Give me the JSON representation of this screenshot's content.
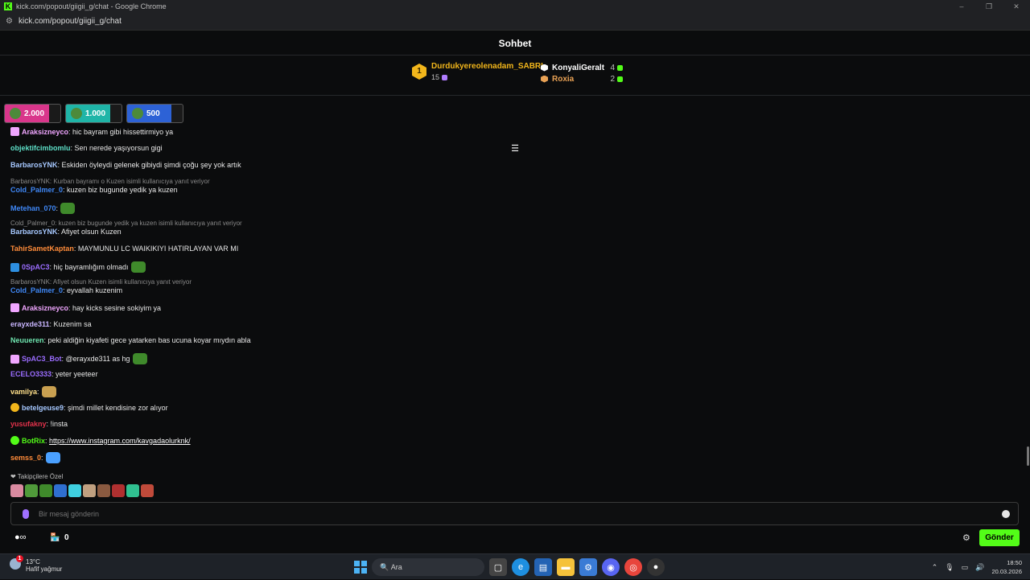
{
  "window": {
    "title": "kick.com/popout/giigii_g/chat - Google Chrome",
    "url": "kick.com/popout/giigii_g/chat",
    "controls": [
      "–",
      "❐",
      "✕"
    ]
  },
  "chat": {
    "title": "Sohbet"
  },
  "leaderboard": {
    "first": {
      "rank": "1",
      "name": "Durdukyereolenadam_SABRI",
      "count": "15"
    },
    "second": {
      "name": "KonyaliGeralt",
      "count": "4"
    },
    "third": {
      "name": "Roxia",
      "count": "2"
    },
    "colors": {
      "first": "#f2b61b",
      "second": "#ffffff",
      "third": "#e9a255"
    }
  },
  "gifts": [
    {
      "amount": "2.000",
      "color": "#d9368b"
    },
    {
      "amount": "1.000",
      "color": "#1fb5a8"
    },
    {
      "amount": "500",
      "color": "#2d62d6"
    }
  ],
  "messages": [
    {
      "user": "Araksizneyco",
      "color": "#f0a6ff",
      "text": ": hic bayram gibi hissettirmiyo ya",
      "badge": "butterfly"
    },
    {
      "user": "objektifcimbomlu",
      "color": "#5ee0c8",
      "text": ": Sen nerede yaşıyorsun gigi"
    },
    {
      "user": "BarbarosYNK",
      "color": "#a6c8ff",
      "text": ": Eskiden öyleydi gelenek gibiydi şimdi çoğu şey yok artık"
    },
    {
      "reply": "BarbarosYNK: Kurban bayramı o Kuzen isimli kullanıcıya yanıt veriyor",
      "user": "Cold_Palmer_0",
      "color": "#3f87f5",
      "text": ": kuzen biz bugunde yedik ya kuzen"
    },
    {
      "user": "Metehan_070",
      "color": "#3f87f5",
      "text": ":",
      "emote": "frog"
    },
    {
      "reply": "Cold_Palmer_0: kuzen biz bugunde yedik ya kuzen isimli kullanıcıya yanıt veriyor",
      "user": "BarbarosYNK",
      "color": "#a6c8ff",
      "text": ": Afiyet olsun Kuzen"
    },
    {
      "user": "TahirSametKaptan",
      "color": "#ff8c3a",
      "text": ": MAYMUNLU LC WAIKIKIYI HATIRLAYAN VAR MI"
    },
    {
      "user": "0SpAC3",
      "color": "#9b6dff",
      "text": ": hiç bayramlığım olmadı",
      "badge": "sub",
      "emote": "frog"
    },
    {
      "reply": "BarbarosYNK: Afiyet olsun Kuzen isimli kullanıcıya yanıt veriyor",
      "user": "Cold_Palmer_0",
      "color": "#3f87f5",
      "text": ": eyvallah kuzenim"
    },
    {
      "user": "Araksizneyco",
      "color": "#f0a6ff",
      "text": ": hay kicks sesine sokiyim ya",
      "badge": "butterfly"
    },
    {
      "user": "erayxde311",
      "color": "#c9b6ff",
      "text": ": Kuzenim sa"
    },
    {
      "user": "Neuueren",
      "color": "#6fe6b0",
      "text": ": peki aldiğin kiyafeti gece yatarken bas ucuna koyar mıydın abla"
    },
    {
      "user": "SpAC3_Bot",
      "color": "#9b6dff",
      "text": ": @erayxde311 as hg",
      "badge": "butterfly",
      "emote": "frog"
    },
    {
      "user": "ECELO3333",
      "color": "#9b6dff",
      "text": ": yeter yeeteer"
    },
    {
      "user": "vamilya",
      "color": "#ffe08a",
      "text": ":",
      "emote": "hands"
    },
    {
      "user": "betelgeuse9",
      "color": "#a6c8ff",
      "text": ": şimdi millet kendisine zor alıyor",
      "badge": "gold"
    },
    {
      "user": "yusufakny",
      "color": "#e2324b",
      "text": ": !insta"
    },
    {
      "user": "BotRix",
      "color": "#53fc18",
      "text": ": ",
      "link": "https://www.instagram.com/kavgadaolurknk/",
      "badge": "verified"
    },
    {
      "user": "semss_0",
      "color": "#ff8c3a",
      "text": ":",
      "emote": "butterfly"
    }
  ],
  "follow_label": "❤ Takipçilere Özel",
  "input": {
    "placeholder": "Bir mesaj gönderin"
  },
  "bottom": {
    "kicks": "∞",
    "store_count": "0",
    "send_label": "Gönder"
  },
  "taskbar": {
    "temp": "13°C",
    "weather": "Hafif yağmur",
    "search": "Ara",
    "time": "18:50",
    "date": "20.03.2026",
    "notif": "1"
  }
}
